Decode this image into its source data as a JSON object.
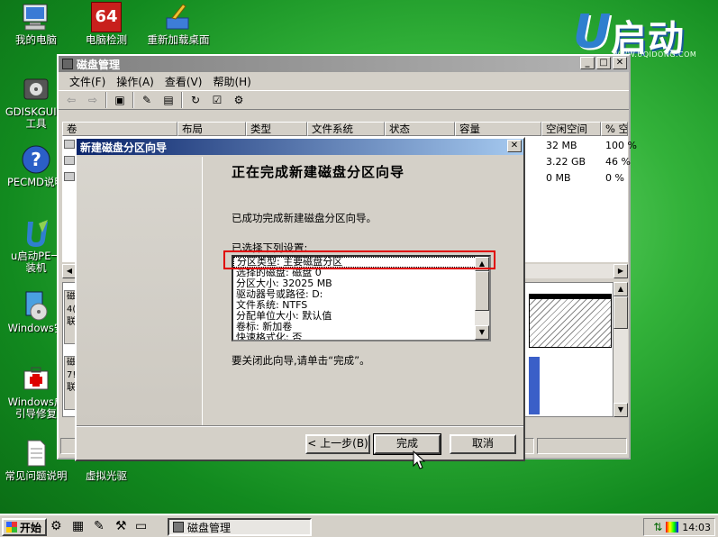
{
  "desktop": {
    "icons": [
      {
        "label": "我的电脑"
      },
      {
        "label": "电脑检测",
        "badge": "64"
      },
      {
        "label": "重新加载桌面"
      },
      {
        "label": "GDISKGUI分\n工具"
      },
      {
        "label": "PECMD说明"
      },
      {
        "label": "u启动PE一\n装机"
      },
      {
        "label": "Windows安"
      },
      {
        "label": "Windows启\n引导修复"
      },
      {
        "label": "常见问题说明"
      },
      {
        "label": "虚拟光驱"
      }
    ],
    "brand": {
      "text": "启动",
      "url": "WWW.UQIDONG.COM"
    }
  },
  "main_window": {
    "title": "磁盘管理",
    "menu": [
      "文件(F)",
      "操作(A)",
      "查看(V)",
      "帮助(H)"
    ],
    "columns": [
      "卷",
      "布局",
      "类型",
      "文件系统",
      "状态",
      "容量",
      "空闲空间",
      "% 空"
    ],
    "rows": [
      {
        "free": "32 MB",
        "pct": "100 %"
      },
      {
        "free": "3.22 GB",
        "pct": "46 %"
      },
      {
        "free": "0 MB",
        "pct": "0 %"
      }
    ],
    "lower_labels": [
      "磁",
      "4(",
      "联",
      "磁",
      "7!",
      "联"
    ]
  },
  "wizard": {
    "title": "新建磁盘分区向导",
    "heading": "正在完成新建磁盘分区向导",
    "success_text": "已成功完成新建磁盘分区向导。",
    "settings_label": "已选择下列设置:",
    "settings": [
      "分区类型: 主要磁盘分区",
      "选择的磁盘: 磁盘 0",
      "分区大小: 32025 MB",
      "驱动器号或路径: D:",
      "文件系统: NTFS",
      "分配单位大小: 默认值",
      "卷标: 新加卷",
      "快速格式化: 否"
    ],
    "close_hint": "要关闭此向导,请单击“完成”。",
    "buttons": {
      "back": "< 上一步(B)",
      "finish": "完成",
      "cancel": "取消"
    }
  },
  "taskbar": {
    "start_label": "开始",
    "task_label": "磁盘管理",
    "clock": "14:03"
  }
}
